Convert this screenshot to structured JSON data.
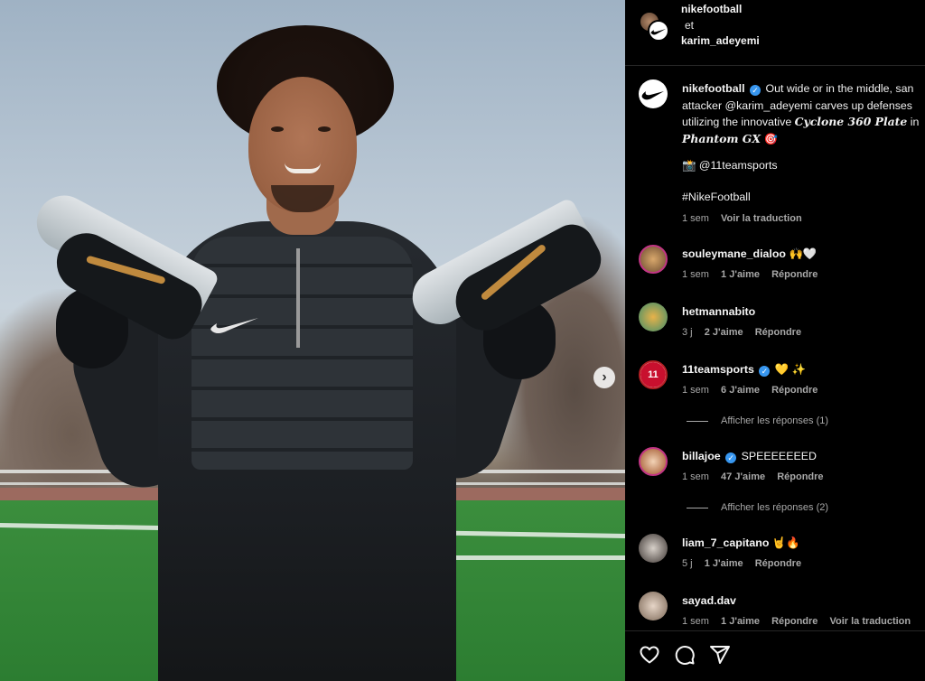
{
  "post": {
    "image_alt": "Footballer holding two Nike Phantom GX boots",
    "header": {
      "user1": "nikefootball",
      "conjunction": "et",
      "user2": "karim_adeyemi"
    },
    "caption": {
      "username": "nikefootball",
      "text_line1": "Out wide or in the middle, san",
      "text_line2": "attacker @karim_adeyemi carves up defenses",
      "text_line3_pre": "utilizing the innovative ",
      "text_line3_bold": "Cyclone 360 Plate",
      "text_line3_post": " in",
      "text_line4_bold": "Phantom GX",
      "text_line4_emoji": "🎯",
      "camera_credit": "📸 @11teamsports",
      "hashtag": "#NikeFootball",
      "time": "1 sem",
      "translate": "Voir la traduction"
    },
    "comments": [
      {
        "username": "souleymane_dialoo",
        "text": "🙌🤍",
        "time": "1 sem",
        "likes": "1 J'aime",
        "reply": "Répondre"
      },
      {
        "username": "hetmannabito",
        "text": "",
        "time": "3 j",
        "likes": "2 J'aime",
        "reply": "Répondre"
      },
      {
        "username": "11teamsports",
        "text": "💛 ✨",
        "time": "1 sem",
        "likes": "6 J'aime",
        "reply": "Répondre",
        "show_replies": "Afficher les réponses (1)"
      },
      {
        "username": "billajoe",
        "text": "SPEEEEEEED",
        "time": "1 sem",
        "likes": "47 J'aime",
        "reply": "Répondre",
        "show_replies": "Afficher les réponses (2)"
      },
      {
        "username": "liam_7_capitano",
        "text": "🤘🔥",
        "time": "5 j",
        "likes": "1 J'aime",
        "reply": "Répondre"
      },
      {
        "username": "sayad.dav",
        "text": "",
        "time": "1 sem",
        "likes": "1 J'aime",
        "reply": "Répondre",
        "translate": "Voir la traduction"
      }
    ]
  }
}
